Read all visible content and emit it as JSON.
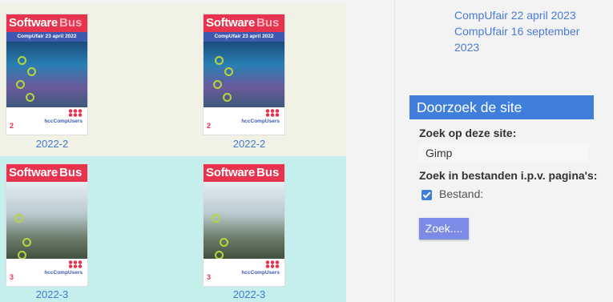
{
  "magazines": {
    "row1": [
      {
        "masthead_a": "Software",
        "masthead_b": "Bus",
        "subtitle": "CompUfair 23 april 2022",
        "issue_num": "2",
        "logo": "hccCompUsers",
        "caption": "2022-2"
      },
      {
        "masthead_a": "Software",
        "masthead_b": "Bus",
        "subtitle": "CompUfair 23 april 2022",
        "issue_num": "2",
        "logo": "hccCompUsers",
        "caption": "2022-2"
      }
    ],
    "row2": [
      {
        "masthead_a": "Software",
        "masthead_b": "Bus",
        "issue_num": "3",
        "logo": "hccCompUsers",
        "caption": "2022-3"
      },
      {
        "masthead_a": "Software",
        "masthead_b": "Bus",
        "issue_num": "3",
        "logo": "hccCompUsers",
        "caption": "2022-3"
      }
    ]
  },
  "sidebar": {
    "links": [
      "CompUfair 22 april 2023",
      "CompUfair 16 september 2023"
    ],
    "search_panel": {
      "title": "Doorzoek de site",
      "site_label": "Zoek op deze site:",
      "query": "Gimp",
      "files_label": "Zoek in bestanden i.p.v. pagina's:",
      "checkbox_label": "Bestand:",
      "checkbox_checked": true,
      "button_label": "Zoek...."
    }
  },
  "colors": {
    "accent": "#3f7fdb",
    "link": "#4a7bd3",
    "button": "#7c8be6",
    "row1_bg": "#f2f1e6",
    "row2_bg": "#c5efed"
  }
}
